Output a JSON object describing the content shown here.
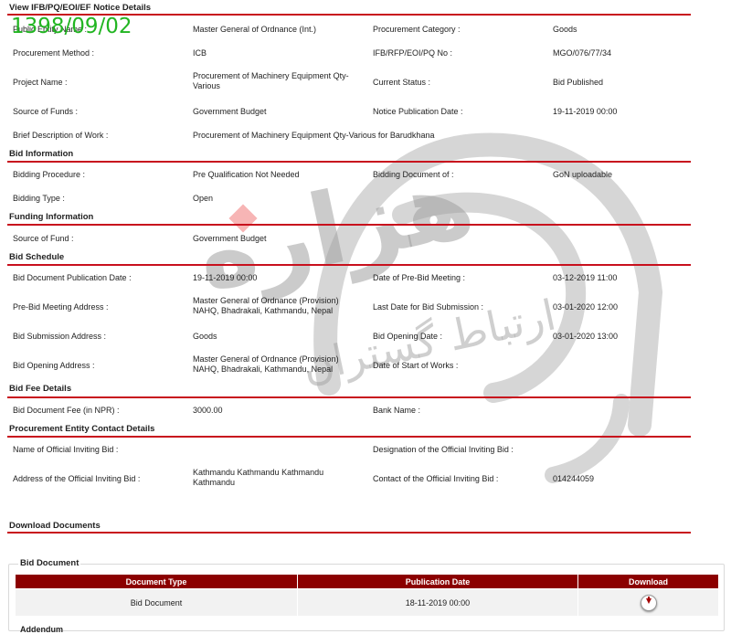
{
  "stamp": "1398/09/02",
  "watermark": {
    "text": "هزاره",
    "subtext": "ارتباط گستران"
  },
  "notice": {
    "title": "View IFB/PQ/EOI/EF Notice Details",
    "rows": [
      {
        "l1": "Public Entity Name :",
        "v1": "Master General of Ordnance (Int.)",
        "l2": "Procurement Category :",
        "v2": "Goods"
      },
      {
        "l1": "Procurement Method :",
        "v1": "ICB",
        "l2": "IFB/RFP/EOI/PQ No :",
        "v2": "MGO/076/77/34"
      },
      {
        "l1": "Project Name :",
        "v1": "Procurement of Machinery Equipment Qty-Various",
        "l2": "Current Status :",
        "v2": "Bid Published"
      },
      {
        "l1": "Source of Funds :",
        "v1": "Government Budget",
        "l2": "Notice Publication Date :",
        "v2": "19-11-2019 00:00"
      },
      {
        "l1": "Brief Description of Work :",
        "v1": "Procurement of Machinery Equipment Qty-Various for Barudkhana"
      }
    ]
  },
  "bid_info": {
    "title": "Bid Information",
    "rows": [
      {
        "l1": "Bidding Procedure :",
        "v1": "Pre Qualification Not Needed",
        "l2": "Bidding Document of :",
        "v2": "GoN uploadable"
      },
      {
        "l1": "Bidding Type :",
        "v1": "Open"
      }
    ]
  },
  "funding": {
    "title": "Funding Information",
    "rows": [
      {
        "l1": "Source of Fund :",
        "v1": "Government Budget"
      }
    ]
  },
  "schedule": {
    "title": "Bid Schedule",
    "rows": [
      {
        "l1": "Bid Document Publication Date :",
        "v1": "19-11-2019 00:00",
        "l2": "Date of Pre-Bid Meeting :",
        "v2": "03-12-2019 11:00"
      },
      {
        "l1": "Pre-Bid Meeting Address :",
        "v1": "Master General of Ordnance (Provision) NAHQ, Bhadrakali, Kathmandu, Nepal",
        "l2": "Last Date for Bid Submission :",
        "v2": "03-01-2020 12:00"
      },
      {
        "l1": "Bid Submission Address :",
        "v1": "Goods",
        "l2": "Bid Opening Date :",
        "v2": "03-01-2020 13:00"
      },
      {
        "l1": "Bid Opening Address :",
        "v1": "Master General of Ordnance (Provision) NAHQ, Bhadrakali, Kathmandu, Nepal",
        "l2": "Date of Start of Works :",
        "v2": ""
      }
    ]
  },
  "fee": {
    "title": "Bid Fee Details",
    "rows": [
      {
        "l1": "Bid Document Fee (in NPR) :",
        "v1": "3000.00",
        "l2": "Bank Name :",
        "v2": ""
      }
    ]
  },
  "contact": {
    "title": "Procurement Entity Contact Details",
    "rows": [
      {
        "l1": "Name of Official Inviting Bid :",
        "v1": "",
        "l2": "Designation of the Official Inviting Bid :",
        "v2": ""
      },
      {
        "l1": "Address of the Official Inviting Bid :",
        "v1": "Kathmandu Kathmandu Kathmandu Kathmandu",
        "l2": "Contact of the Official Inviting Bid :",
        "v2": "014244059"
      }
    ]
  },
  "downloads": {
    "title": "Download Documents",
    "box_title": "Bid Document",
    "columns": [
      "Document Type",
      "Publication Date",
      "Download"
    ],
    "rows": [
      {
        "type": "Bid Document",
        "date": "18-11-2019 00:00",
        "download_icon": "download-icon"
      }
    ],
    "next_section": "Addendum"
  },
  "colors": {
    "accent_red": "#c8101d",
    "header_dark_red": "#8b0000",
    "stamp_green": "#22b522",
    "watermark_gray": "#9a9a9a"
  }
}
